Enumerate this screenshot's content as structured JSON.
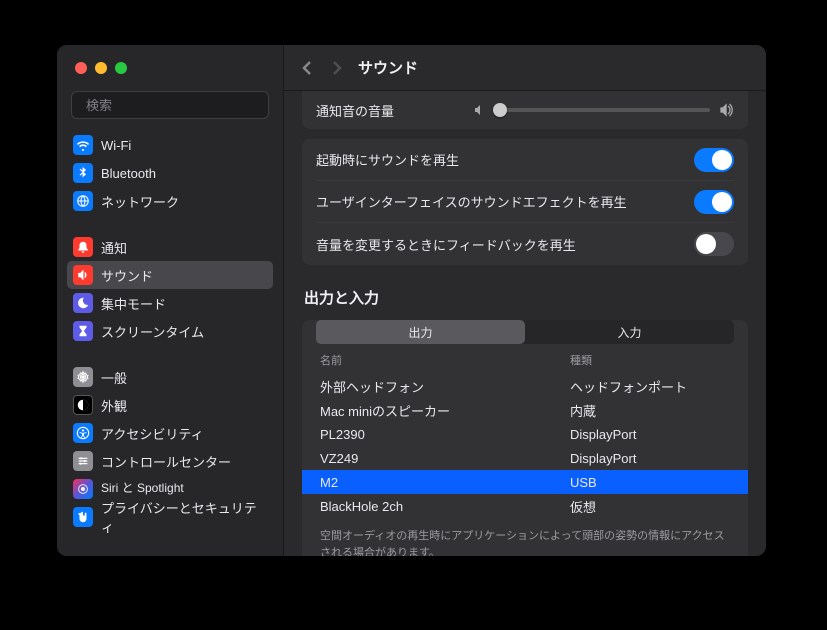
{
  "header": {
    "title": "サウンド"
  },
  "search": {
    "placeholder": "検索"
  },
  "sidebar": {
    "groups": [
      {
        "items": [
          {
            "label": "Wi-Fi",
            "icon": "wifi-icon",
            "ic": "ic-blue"
          },
          {
            "label": "Bluetooth",
            "icon": "bluetooth-icon",
            "ic": "ic-blue"
          },
          {
            "label": "ネットワーク",
            "icon": "globe-icon",
            "ic": "ic-blue"
          }
        ]
      },
      {
        "items": [
          {
            "label": "通知",
            "icon": "bell-icon",
            "ic": "ic-red"
          },
          {
            "label": "サウンド",
            "icon": "speaker-icon",
            "ic": "ic-red",
            "selected": true
          },
          {
            "label": "集中モード",
            "icon": "moon-icon",
            "ic": "ic-purple"
          },
          {
            "label": "スクリーンタイム",
            "icon": "hourglass-icon",
            "ic": "ic-purple"
          }
        ]
      },
      {
        "items": [
          {
            "label": "一般",
            "icon": "gear-icon",
            "ic": "ic-gray"
          },
          {
            "label": "外観",
            "icon": "contrast-icon",
            "ic": "ic-black"
          },
          {
            "label": "アクセシビリティ",
            "icon": "accessibility-icon",
            "ic": "ic-blue"
          },
          {
            "label": "コントロールセンター",
            "icon": "sliders-icon",
            "ic": "ic-gray"
          },
          {
            "label": "Siri と Spotlight",
            "icon": "siri-icon",
            "ic": "ic-grad"
          },
          {
            "label": "プライバシーとセキュリティ",
            "icon": "hand-icon",
            "ic": "ic-blue"
          }
        ]
      }
    ]
  },
  "sound": {
    "alert_volume_label": "通知音の音量",
    "alert_volume_value": 0,
    "rows": [
      {
        "label": "起動時にサウンドを再生",
        "on": true
      },
      {
        "label": "ユーザインターフェイスのサウンドエフェクトを再生",
        "on": true
      },
      {
        "label": "音量を変更するときにフィードバックを再生",
        "on": false
      }
    ],
    "io_title": "出力と入力",
    "tabs": {
      "output": "出力",
      "input": "入力"
    },
    "columns": {
      "name": "名前",
      "type": "種類"
    },
    "devices": [
      {
        "name": "外部ヘッドフォン",
        "type": "ヘッドフォンポート"
      },
      {
        "name": "Mac miniのスピーカー",
        "type": "内蔵"
      },
      {
        "name": "PL2390",
        "type": "DisplayPort"
      },
      {
        "name": "VZ249",
        "type": "DisplayPort"
      },
      {
        "name": "M2",
        "type": "USB",
        "selected": true
      },
      {
        "name": "BlackHole 2ch",
        "type": "仮想"
      }
    ],
    "footnote": "空間オーディオの再生時にアプリケーションによって頭部の姿勢の情報にアクセスされる場合があります。"
  }
}
